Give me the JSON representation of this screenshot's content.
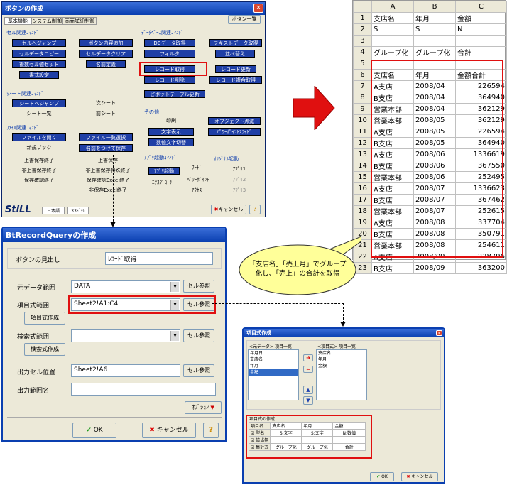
{
  "main_window": {
    "title": "ボタンの作成",
    "tabs": [
      "基本機能",
      "システム制御",
      "画面詳細制御"
    ],
    "list_button": "ボタン一覧",
    "cell_group": "セル関連ｺﾏﾝﾄﾞ",
    "cell_buttons": [
      "セルへジャンプ",
      "ボタン内容追加",
      "セルデータコピー",
      "セルデータクリア",
      "複数セル値セット",
      "名前定義",
      "書式設定"
    ],
    "db_group": "ﾃﾞｰﾀﾍﾞｰｽ関連ｺﾏﾝﾄﾞ",
    "db_buttons": [
      "DBデータ取得",
      "テキストデータ取得",
      "フィルタ",
      "並べ替え",
      "レコード取得",
      "レコード更新",
      "レコード削除",
      "レコード複合取得",
      "ピボットテーブル更新"
    ],
    "sheet_group": "シート関連ｺﾏﾝﾄﾞ",
    "sheet_buttons": [
      "シートへジャンプ",
      "次シート",
      "シート一覧",
      "前シート"
    ],
    "other_group": "その他",
    "other_buttons": [
      "印刷",
      "オブジェクト点滅",
      "文字表示",
      "ﾊﾟﾜｰﾎﾟｲﾝﾄｽﾗｲﾄﾞ",
      "数値文字切替"
    ],
    "file_group": "ﾌｧｲﾙ関連ｺﾏﾝﾄﾞ",
    "file_buttons": [
      "ファイルを開く",
      "ファイル一覧選択",
      "新規ブック",
      "名前をつけて保存",
      "上書保存終了",
      "上書保存",
      "非上書保存終了",
      "非上書保存特殊終了",
      "保存確認終了",
      "保存確認Excel終了",
      "非保存Excel終了"
    ],
    "app_group": "ｱﾌﾟﾘ起動ｺﾏﾝﾄﾞ",
    "app_buttons": [
      "ｱﾌﾟﾘ起動",
      "ﾜｰﾄﾞ",
      "ｴｸｽﾌﾟﾛｰﾗ",
      "ﾊﾟﾜｰﾎﾟｲﾝﾄ",
      "ｱｸｾｽ"
    ],
    "orig_group": "ｵﾘｼﾞﾅﾙ起動",
    "orig_buttons": [
      "ｱﾌﾟﾘ1",
      "ｱﾌﾟﾘ2",
      "ｱﾌﾟﾘ3"
    ],
    "logo": "StiLL",
    "lang": "日本語",
    "size": "33ﾄﾞｯﾄ",
    "cancel": "キャンセル",
    "help": "?"
  },
  "query_window": {
    "title": "BtRecordQueryの作成",
    "caption_label": "ボタンの見出し",
    "caption_value": "ﾚｺｰﾄﾞ取得",
    "source_label": "元データ範囲",
    "source_value": "DATA",
    "item_label": "項目式範囲",
    "item_value": "Sheet2!A1:C4",
    "item_create": "項目式作成",
    "search_label": "検索式範囲",
    "search_value": "",
    "search_create": "検索式作成",
    "out_cell_label": "出力セル位置",
    "out_cell_value": "Sheet2!A6",
    "out_name_label": "出力範囲名",
    "out_name_value": "",
    "cell_ref": "セル参照",
    "option": "ｵﾌﾟｼｮﾝ",
    "ok": "OK",
    "cancel": "キャンセル",
    "help": "?"
  },
  "item_window": {
    "title": "項目式作成",
    "left_header": "<元データ> 項目一覧",
    "left_items": [
      "年月日",
      "支店名",
      "年月",
      "金額"
    ],
    "right_header": "<項目式> 項目一覧",
    "right_items": [
      "支店名",
      "年月",
      "金額"
    ],
    "section": "項目式の作成",
    "cols": [
      "項目名",
      "支店名",
      "年月",
      "金額"
    ],
    "rows": [
      [
        "型名",
        "S:文字",
        "S:文字",
        "N:数値"
      ],
      [
        "該当無",
        "",
        " ",
        ""
      ],
      [
        "集計式",
        "グループ化",
        "グループ化",
        "合計"
      ]
    ],
    "ok": "OK",
    "cancel": "キャンセル"
  },
  "sheet": {
    "cols": [
      "A",
      "B",
      "C"
    ],
    "rows": [
      [
        "1",
        "支店名",
        "年月",
        "金額"
      ],
      [
        "2",
        "S",
        "S",
        "N"
      ],
      [
        "3",
        "",
        "",
        ""
      ],
      [
        "4",
        "グループ化",
        "グループ化",
        "合計"
      ],
      [
        "5",
        "",
        "",
        ""
      ],
      [
        "6",
        "支店名",
        "年月",
        "金額合計"
      ],
      [
        "7",
        "A支店",
        "2008/04",
        "226594"
      ],
      [
        "8",
        "B支店",
        "2008/04",
        "364940"
      ],
      [
        "9",
        "営業本部",
        "2008/04",
        "362129"
      ],
      [
        "10",
        "営業本部",
        "2008/05",
        "362129"
      ],
      [
        "11",
        "A支店",
        "2008/05",
        "226594"
      ],
      [
        "12",
        "B支店",
        "2008/05",
        "364940"
      ],
      [
        "13",
        "A支店",
        "2008/06",
        "1336619"
      ],
      [
        "14",
        "B支店",
        "2008/06",
        "367550"
      ],
      [
        "15",
        "営業本部",
        "2008/06",
        "252495"
      ],
      [
        "16",
        "A支店",
        "2008/07",
        "1336623"
      ],
      [
        "17",
        "B支店",
        "2008/07",
        "367462"
      ],
      [
        "18",
        "営業本部",
        "2008/07",
        "252615"
      ],
      [
        "19",
        "A支店",
        "2008/08",
        "337704"
      ],
      [
        "20",
        "B支店",
        "2008/08",
        "350791"
      ],
      [
        "21",
        "営業本部",
        "2008/08",
        "254611"
      ],
      [
        "22",
        "A支店",
        "2008/09",
        "228796"
      ],
      [
        "23",
        "B支店",
        "2008/09",
        "363200"
      ]
    ]
  },
  "callout": "「支店名」「売上月」でグループ化し、「売上」の合計を取得",
  "colors": {
    "title": "#0a3fb0",
    "blue_button": "#1f3fa6",
    "highlight": "#e01010",
    "arrow": "#e01010"
  }
}
